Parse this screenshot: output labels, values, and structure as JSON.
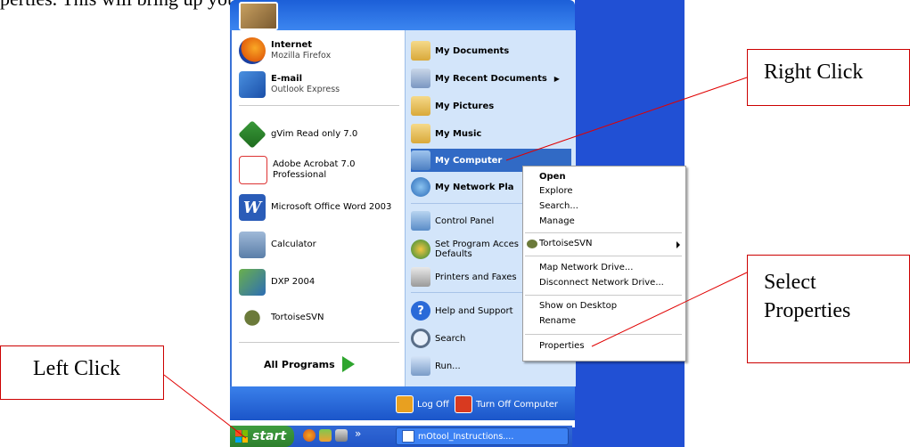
{
  "document": {
    "fragment_text": "perties.  This will bring up your system properties window."
  },
  "start_menu": {
    "pinned": [
      {
        "title": "Internet",
        "subtitle": "Mozilla Firefox"
      },
      {
        "title": "E-mail",
        "subtitle": "Outlook Express"
      }
    ],
    "recent": [
      {
        "label": "gVim Read only 7.0"
      },
      {
        "label": "Adobe Acrobat 7.0 Professional"
      },
      {
        "label": "Microsoft Office Word 2003"
      },
      {
        "label": "Calculator"
      },
      {
        "label": "DXP 2004"
      },
      {
        "label": "TortoiseSVN"
      }
    ],
    "all_programs": "All Programs",
    "right_column": [
      {
        "label": "My Documents"
      },
      {
        "label": "My Recent Documents"
      },
      {
        "label": "My Pictures"
      },
      {
        "label": "My Music"
      },
      {
        "label": "My Computer"
      },
      {
        "label": "My Network Pla"
      },
      {
        "label": "Control Panel"
      },
      {
        "label": "Set Program Acces",
        "label2": "Defaults"
      },
      {
        "label": "Printers and Faxes"
      },
      {
        "label": "Help and Support"
      },
      {
        "label": "Search"
      },
      {
        "label": "Run..."
      }
    ],
    "log_off": "Log Off",
    "turn_off": "Turn Off Computer"
  },
  "context_menu": {
    "items": [
      "Open",
      "Explore",
      "Search...",
      "Manage",
      "TortoiseSVN",
      "Map Network Drive...",
      "Disconnect Network Drive...",
      "Show on Desktop",
      "Rename",
      "Properties"
    ]
  },
  "taskbar": {
    "start_label": "start",
    "overflow": "»",
    "task_button": "mOtool_Instructions...."
  },
  "callouts": {
    "right_click": "Right Click",
    "select_properties_line1": "Select",
    "select_properties_line2": "Properties",
    "left_click": "Left Click"
  },
  "colors": {
    "xp_blue": "#2150d4",
    "start_green": "#3f9d3f",
    "callout_border": "#cc0000",
    "selected": "#316ac5"
  }
}
